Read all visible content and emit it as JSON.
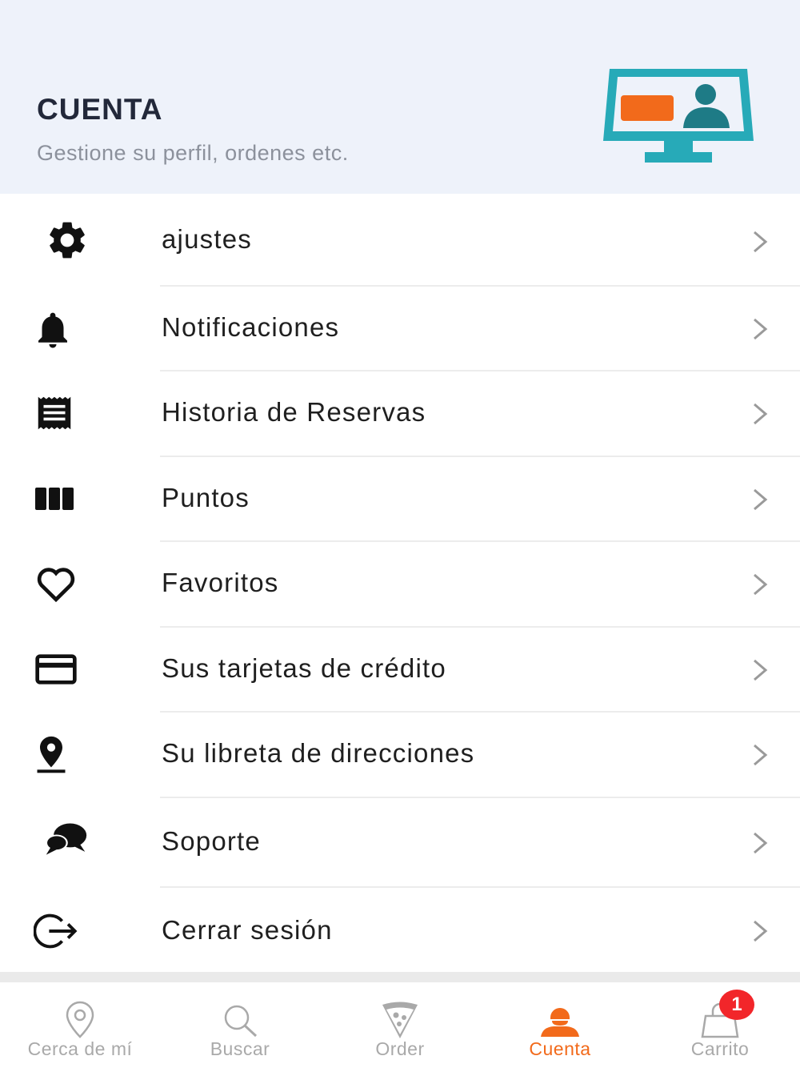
{
  "header": {
    "title": "CUENTA",
    "subtitle": "Gestione su perfil, ordenes etc.",
    "illustration_icon": "monitor-profile-icon",
    "colors": {
      "background": "#eef2fa",
      "monitor": "#27aab8",
      "card": "#f26a1b",
      "person": "#1e7b86"
    }
  },
  "menu": {
    "items": [
      {
        "label": "ajustes",
        "icon": "gear-icon"
      },
      {
        "label": "Notificaciones",
        "icon": "bell-icon"
      },
      {
        "label": "Historia de Reservas",
        "icon": "receipt-icon"
      },
      {
        "label": "Puntos",
        "icon": "columns-icon"
      },
      {
        "label": "Favoritos",
        "icon": "heart-icon"
      },
      {
        "label": "Sus tarjetas de crédito",
        "icon": "credit-card-icon"
      },
      {
        "label": "Su libreta de direcciones",
        "icon": "location-pin-icon"
      },
      {
        "label": "Soporte",
        "icon": "chat-bubbles-icon"
      },
      {
        "label": "Cerrar sesión",
        "icon": "logout-icon"
      }
    ]
  },
  "tabbar": {
    "tabs": [
      {
        "label": "Cerca de mí",
        "icon": "map-pin-icon",
        "active": false
      },
      {
        "label": "Buscar",
        "icon": "search-icon",
        "active": false
      },
      {
        "label": "Order",
        "icon": "pizza-slice-icon",
        "active": false
      },
      {
        "label": "Cuenta",
        "icon": "user-icon",
        "active": true
      },
      {
        "label": "Carrito",
        "icon": "shopping-bag-icon",
        "active": false
      }
    ],
    "cart_badge": "1",
    "active_color": "#f26a1b",
    "inactive_color": "#a9a9a9"
  }
}
